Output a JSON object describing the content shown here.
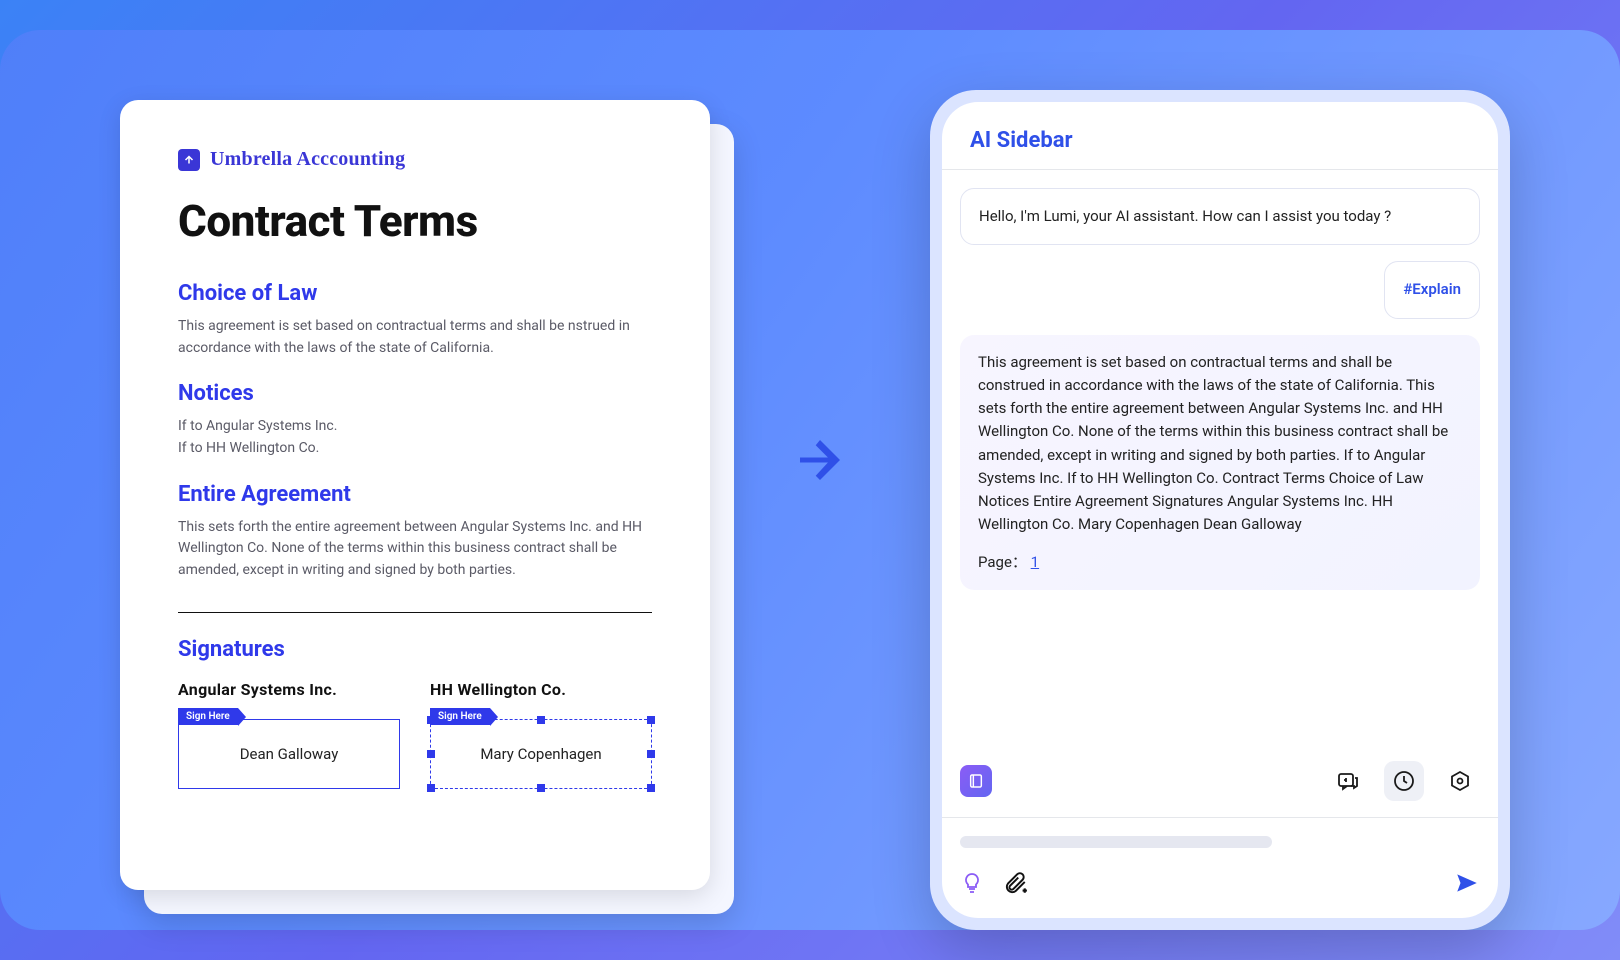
{
  "document": {
    "brand": "Umbrella Acccounting",
    "title": "Contract Terms",
    "sections": {
      "choice_of_law": {
        "heading": "Choice of Law",
        "body": "This agreement is set based on contractual terms and shall be nstrued in accordance with the laws of the state of California."
      },
      "notices": {
        "heading": "Notices",
        "line1": "If to Angular Systems Inc.",
        "line2": "If to HH Wellington Co."
      },
      "entire_agreement": {
        "heading": "Entire Agreement",
        "body": "This sets forth the entire agreement between Angular Systems Inc. and HH Wellington Co. None of the terms within this business contract shall be amended, except in writing and signed by both parties."
      },
      "signatures": {
        "heading": "Signatures",
        "party1": "Angular Systems Inc.",
        "party2": "HH Wellington Co.",
        "sign_tag": "Sign Here",
        "signer1": "Dean Galloway",
        "signer2": "Mary Copenhagen"
      }
    }
  },
  "sidebar": {
    "title": "AI Sidebar",
    "greeting": "Hello, I'm Lumi, your AI assistant. How can I assist you today ?",
    "user_chip": "#Explain",
    "response": "This agreement is set based on contractual terms and shall be construed in accordance with the laws of the state of California. This sets forth the entire agreement between Angular Systems Inc. and HH Wellington Co. None of the terms within this business contract shall be amended, except in writing and signed by both parties. If to Angular Systems Inc. If to HH Wellington Co. Contract Terms Choice of Law Notices Entire Agreement Signatures Angular Systems Inc. HH Wellington Co. Mary Copenhagen Dean Galloway",
    "page_label": "Page：",
    "page_number": "1"
  },
  "colors": {
    "accent": "#2f50e8",
    "doc_blue": "#2f39ea"
  }
}
